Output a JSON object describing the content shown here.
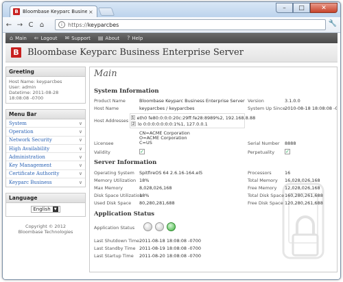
{
  "browser": {
    "tab_title": "Bloombase Keyparc Busine",
    "tab_favicon": "B",
    "url_scheme": "https://",
    "url_host": "keyparcbes"
  },
  "appnav": [
    {
      "icon": "home-icon",
      "glyph": "⌂",
      "label": "Main"
    },
    {
      "icon": "logout-icon",
      "glyph": "⇐",
      "label": "Logout"
    },
    {
      "icon": "support-icon",
      "glyph": "✉",
      "label": "Support"
    },
    {
      "icon": "about-icon",
      "glyph": "▤",
      "label": "About"
    },
    {
      "icon": "help-icon",
      "glyph": "?",
      "label": "Help"
    }
  ],
  "header": {
    "logo_letter": "B",
    "title": "Bloombase Keyparc Business Enterprise Server"
  },
  "greeting": {
    "heading": "Greeting",
    "host": "Host Name: keyparcbes",
    "user": "User: admin",
    "datetime_label": "Datetime: 2011-08-28",
    "datetime_time": "18:08:08 -0700"
  },
  "menubar": {
    "heading": "Menu Bar",
    "items": [
      "System",
      "Operation",
      "Network Security",
      "High Availability",
      "Administration",
      "Key Management",
      "Certificate Authority",
      "Keyparc Business"
    ]
  },
  "language": {
    "heading": "Language",
    "selected": "English"
  },
  "copyright": {
    "line1": "Copyright © 2012",
    "line2": "Bloombase Technologies"
  },
  "main": {
    "title": "Main",
    "system_info": {
      "heading": "System Information",
      "product_name_label": "Product Name",
      "product_name": "Bloombase Keyparc Business Enterprise Server",
      "version_label": "Version",
      "version": "3.1.0.0",
      "host_name_label": "Host Name",
      "host_name": "keyparcbes / keyparcbes",
      "uptime_label": "System Up Since",
      "uptime": "2010-08-18 18:08:08 -0700",
      "host_addresses_label": "Host Addresses",
      "addresses": [
        {
          "num": "1",
          "text": "eth0  fe80:0:0:0:20c:29ff:fe28:8989%2, 192.168.8.88"
        },
        {
          "num": "2",
          "text": "lo     0:0:0:0:0:0:0:1%1, 127.0.0.1"
        }
      ],
      "licensee_label": "Licensee",
      "licensee_lines": [
        "CN=ACME Corporation",
        "O=ACME Corporation",
        "C=US"
      ],
      "serial_label": "Serial Number",
      "serial": "8888",
      "validity_label": "Validity",
      "perpetuality_label": "Perpetuality"
    },
    "server_info": {
      "heading": "Server Information",
      "rows": [
        {
          "l1": "Operating System",
          "v1": "SpitfireOS 64 2.6.16-164.el5",
          "l2": "Processors",
          "v2": "16"
        },
        {
          "l1": "Memory Utilization",
          "v1": "18%",
          "l2": "Total Memory",
          "v2": "16,028,026,168"
        },
        {
          "l1": "Max Memory",
          "v1": "8,028,026,168",
          "l2": "Free Memory",
          "v2": "12,028,026,168"
        },
        {
          "l1": "Disk Space Utilization",
          "v1": "18%",
          "l2": "Total Disk Space",
          "v2": "160,280,261,688"
        },
        {
          "l1": "Used Disk Space",
          "v1": "80,280,281,688",
          "l2": "Free Disk Space",
          "v2": "120,280,261,688"
        }
      ]
    },
    "app_status": {
      "heading": "Application Status",
      "status_label": "Application Status",
      "last_shutdown_label": "Last Shutdown Time",
      "last_shutdown": "2011-08-18 18:08:08 -0700",
      "last_standby_label": "Last Standby Time",
      "last_standby": "2011-08-19 18:08:08 -0700",
      "last_startup_label": "Last Startup Time",
      "last_startup": "2011-08-20 18:08:08 -0700"
    }
  },
  "colors": {
    "brand_red": "#c8201f",
    "menu_link": "#2b63b5",
    "status_green": "#3db33d"
  }
}
